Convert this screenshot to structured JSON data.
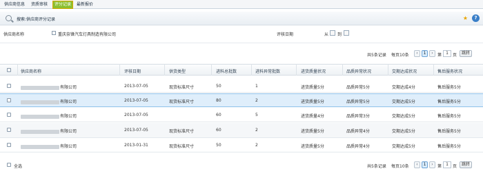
{
  "tabs": [
    {
      "label": "供应商信息"
    },
    {
      "label": "资质审核"
    },
    {
      "label": "评分记录"
    },
    {
      "label": "最新报价"
    }
  ],
  "toolbar": {
    "title": "搜索:供应商评分记录"
  },
  "filter": {
    "supplier_label": "供应商名称",
    "supplier_value": "重庆奈锋汽车灯具制造有限公司",
    "date_label": "评核日期",
    "from_label": "从",
    "to_label": "到"
  },
  "pager": {
    "summary": "共5条记录",
    "per_page": "每页10条",
    "current_page": "1",
    "page_prefix": "第",
    "page_input": "1",
    "page_suffix": "页",
    "jump_label": "跳转"
  },
  "table": {
    "columns": [
      "供应商名称",
      "评核日期",
      "供货类型",
      "进料总批数",
      "进料异常批数",
      "进货质量状况",
      "品质异常状况",
      "交期达成状况",
      "售后服务状况"
    ],
    "rows": [
      {
        "name": "有限公司",
        "date": "2013-07-05",
        "type": "现货标准尺寸",
        "total": "50",
        "abnormal": "1",
        "quality": "进货质量5分",
        "defect": "品质异常5分",
        "delivery": "交期达成4分",
        "service": "售后服务5分"
      },
      {
        "name": "有限公司",
        "date": "2013-07-05",
        "type": "现货标准尺寸",
        "total": "80",
        "abnormal": "2",
        "quality": "进货质量5分",
        "defect": "品质异常5分",
        "delivery": "交期达成5分",
        "service": "售后服务5分"
      },
      {
        "name": "有限公司",
        "date": "2013-07-05",
        "type": "",
        "total": "60",
        "abnormal": "5",
        "quality": "进货质量4分",
        "defect": "品质异常3分",
        "delivery": "交期达成5分",
        "service": "售后服务5分"
      },
      {
        "name": "有限公司",
        "date": "2013-07-05",
        "type": "现货标准尺寸",
        "total": "60",
        "abnormal": "2",
        "quality": "进货质量5分",
        "defect": "品质异常4分",
        "delivery": "交期达成5分",
        "service": "售后服务5分"
      },
      {
        "name": "有限公司",
        "date": "2013-01-31",
        "type": "现货标准尺寸",
        "total": "50",
        "abnormal": "2",
        "quality": "进货质量5分",
        "defect": "品质异常4分",
        "delivery": "交期达成5分",
        "service": "售后服务5分"
      }
    ]
  },
  "footer": {
    "select_all": "全选"
  },
  "colors": {
    "active_tab": "#8bbf2f",
    "selected_row": "#dfeefb",
    "accent": "#3a7fc8"
  }
}
